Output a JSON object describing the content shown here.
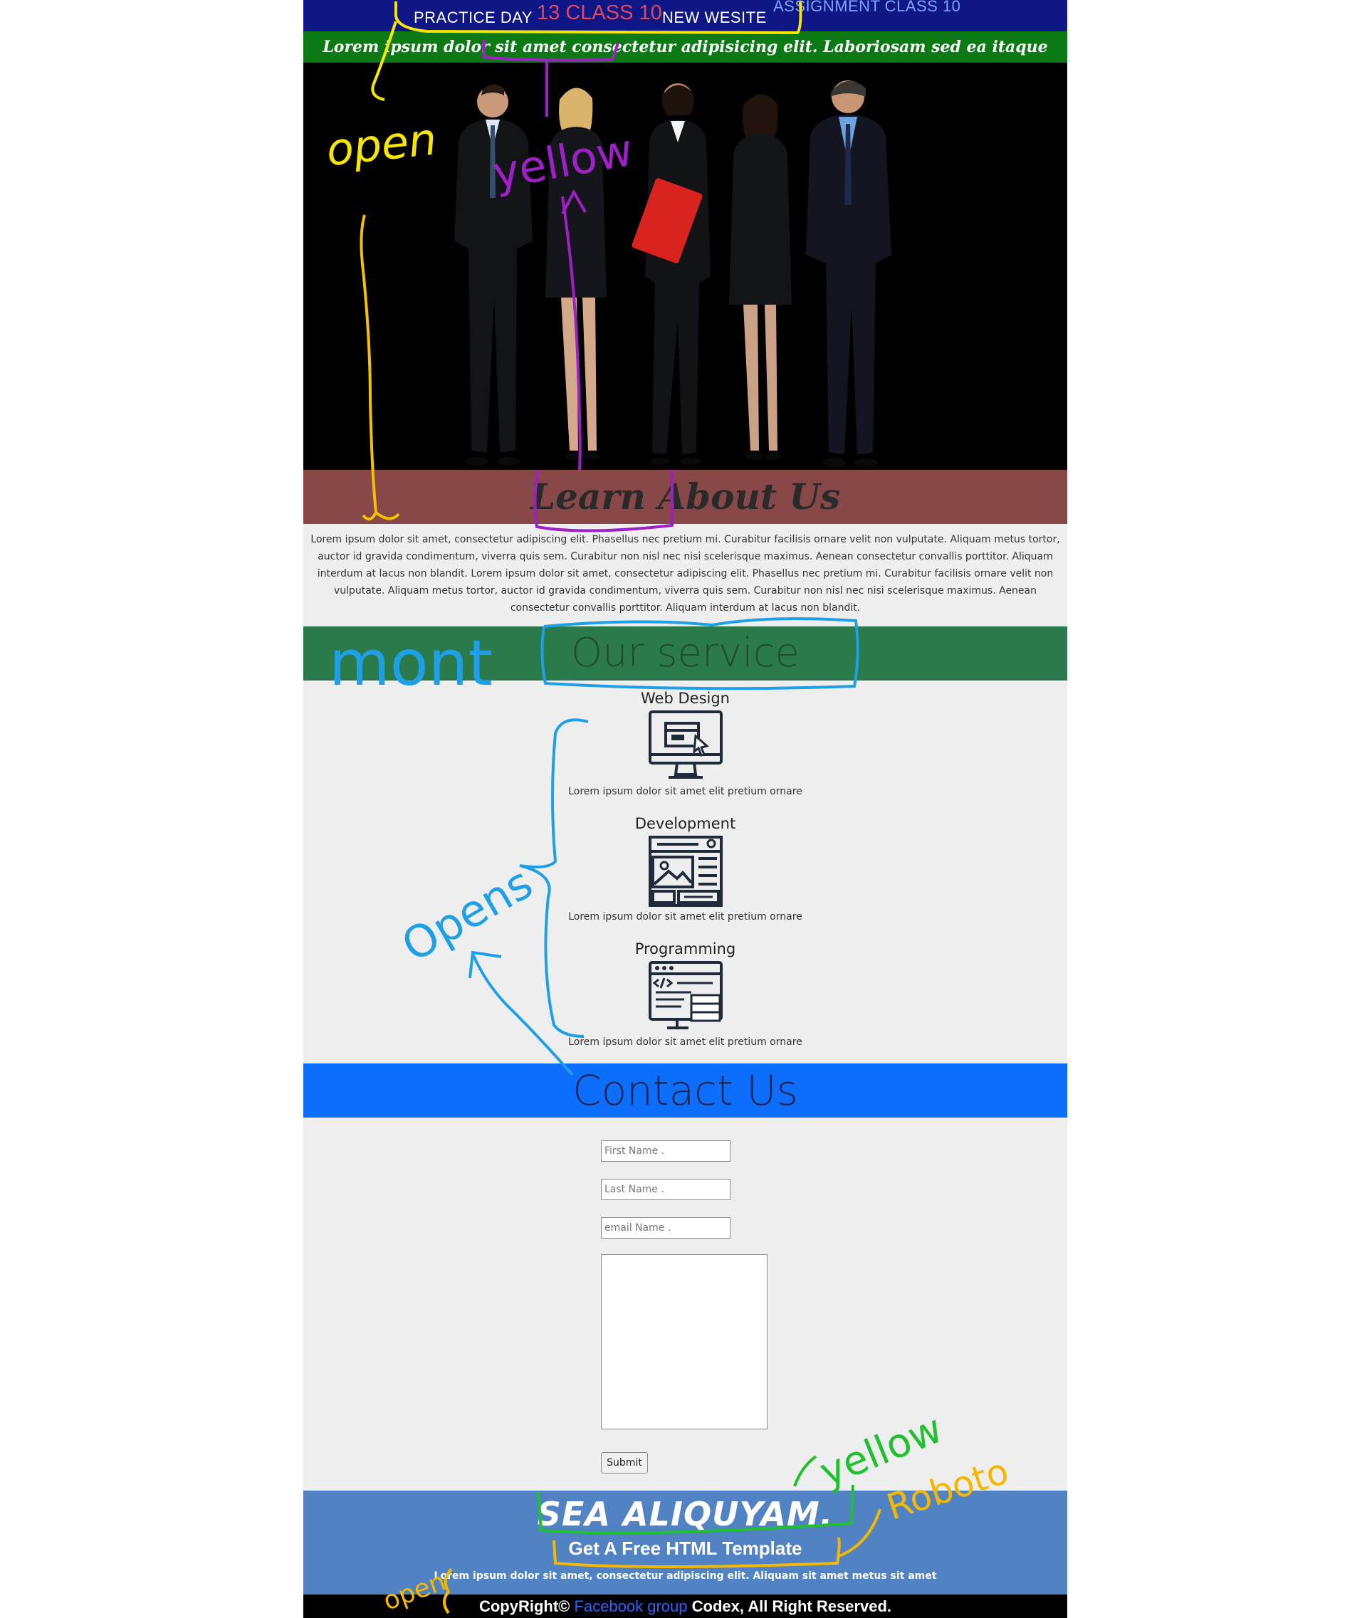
{
  "header": {
    "part1": "PRACTICE DAY",
    "part2": "13 CLASS 10",
    "part3": "NEW WESITE",
    "part4": "ASSIGNMENT CLASS 10"
  },
  "banner": {
    "text": "Lorem ipsum dolor sit amet consectetur adipisicing elit. Laboriosam sed ea itaque exercitationem ."
  },
  "hero": {
    "image": "team-of-five-business-people"
  },
  "about": {
    "heading": "Learn About Us",
    "text": "Lorem ipsum dolor sit amet, consectetur adipiscing elit. Phasellus nec pretium mi. Curabitur facilisis ornare velit non vulputate. Aliquam metus tortor, auctor id gravida condimentum, viverra quis sem. Curabitur non nisl nec nisi scelerisque maximus. Aenean consectetur convallis porttitor. Aliquam interdum at lacus non blandit. Lorem ipsum dolor sit amet, consectetur adipiscing elit. Phasellus nec pretium mi. Curabitur facilisis ornare velit non vulputate. Aliquam metus tortor, auctor id gravida condimentum, viverra quis sem. Curabitur non nisl nec nisi scelerisque maximus. Aenean consectetur convallis porttitor. Aliquam interdum at lacus non blandit."
  },
  "services": {
    "heading": "Our service",
    "items": [
      {
        "title": "Web Design",
        "icon": "monitor-web-design-icon",
        "text": "Lorem ipsum dolor sit amet elit pretium ornare"
      },
      {
        "title": "Development",
        "icon": "website-layout-icon",
        "text": "Lorem ipsum dolor sit amet elit pretium ornare"
      },
      {
        "title": "Programming",
        "icon": "code-window-server-icon",
        "text": "Lorem ipsum dolor sit amet elit pretium ornare"
      }
    ]
  },
  "contact": {
    "heading": "Contact Us",
    "first_name_placeholder": "First Name .",
    "last_name_placeholder": "Last Name .",
    "email_placeholder": "email Name .",
    "submit_label": "Submit"
  },
  "footer": {
    "title": "SEA ALIQUYAM.",
    "subtitle": "Get A Free HTML Template",
    "text": "Lorem ipsum dolor sit amet, consectetur adipiscing elit. Aliquam sit amet metus sit amet",
    "copyright_before": "CopyRight©",
    "link_label": "Facebook group",
    "copyright_after": "Codex, All Right Reserved."
  },
  "annotations": {
    "open_1": "open",
    "yellow_1": "yellow",
    "mont": "mont",
    "opens": "Opens",
    "yellow_2": "yellow",
    "roboto": "Roboto",
    "open_2": "open"
  },
  "colors": {
    "header_bg": "#0f1786",
    "banner_bg": "#0c7a14",
    "about_bg": "#884848",
    "service_bg": "#2b7a4b",
    "contact_bg": "#0d6efd",
    "footer_bg": "#5082c4",
    "section_bg": "#eeeeee"
  }
}
